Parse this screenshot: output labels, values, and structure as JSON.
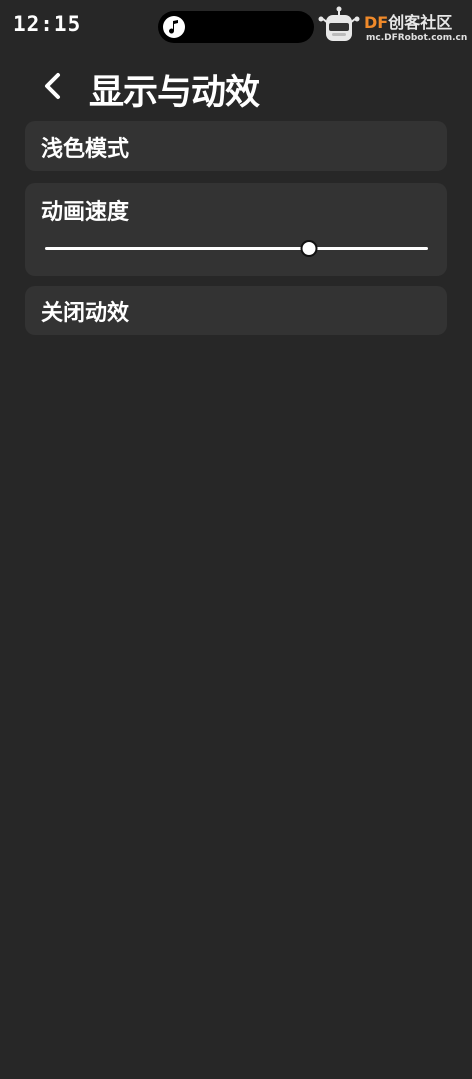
{
  "status_bar": {
    "time": "12:15",
    "island_icon": "music-note-icon"
  },
  "watermark": {
    "brand_df": "DF",
    "brand_rest": "创客社区",
    "url": "mc.DFRobot.com.cn"
  },
  "header": {
    "back_icon": "chevron-left-icon",
    "title": "显示与动效"
  },
  "settings": {
    "light_mode_label": "浅色模式",
    "animation_speed_label": "动画速度",
    "animation_speed_value": 0.69,
    "disable_animation_label": "关闭动效"
  },
  "colors": {
    "background": "#272727",
    "card": "#333333",
    "text": "#ffffff",
    "brand_accent": "#f08a2a"
  }
}
